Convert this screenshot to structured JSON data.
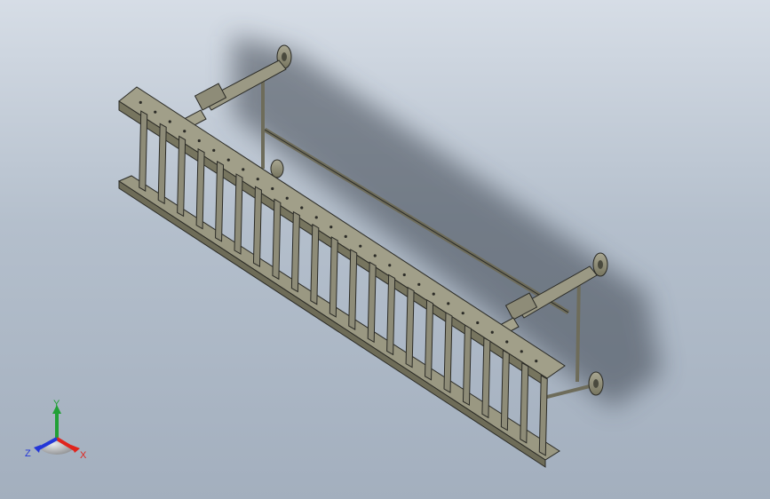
{
  "viewport": {
    "background_top": "#d6dde6",
    "background_bottom": "#a3afbe"
  },
  "model": {
    "part_color": "#8e8c78",
    "part_edge": "#2b2b26",
    "shadow_color": "#3c4450"
  },
  "triad": {
    "x_label": "X",
    "y_label": "Y",
    "z_label": "Z",
    "x_color": "#e0241c",
    "y_color": "#21a035",
    "z_color": "#2336d8"
  }
}
